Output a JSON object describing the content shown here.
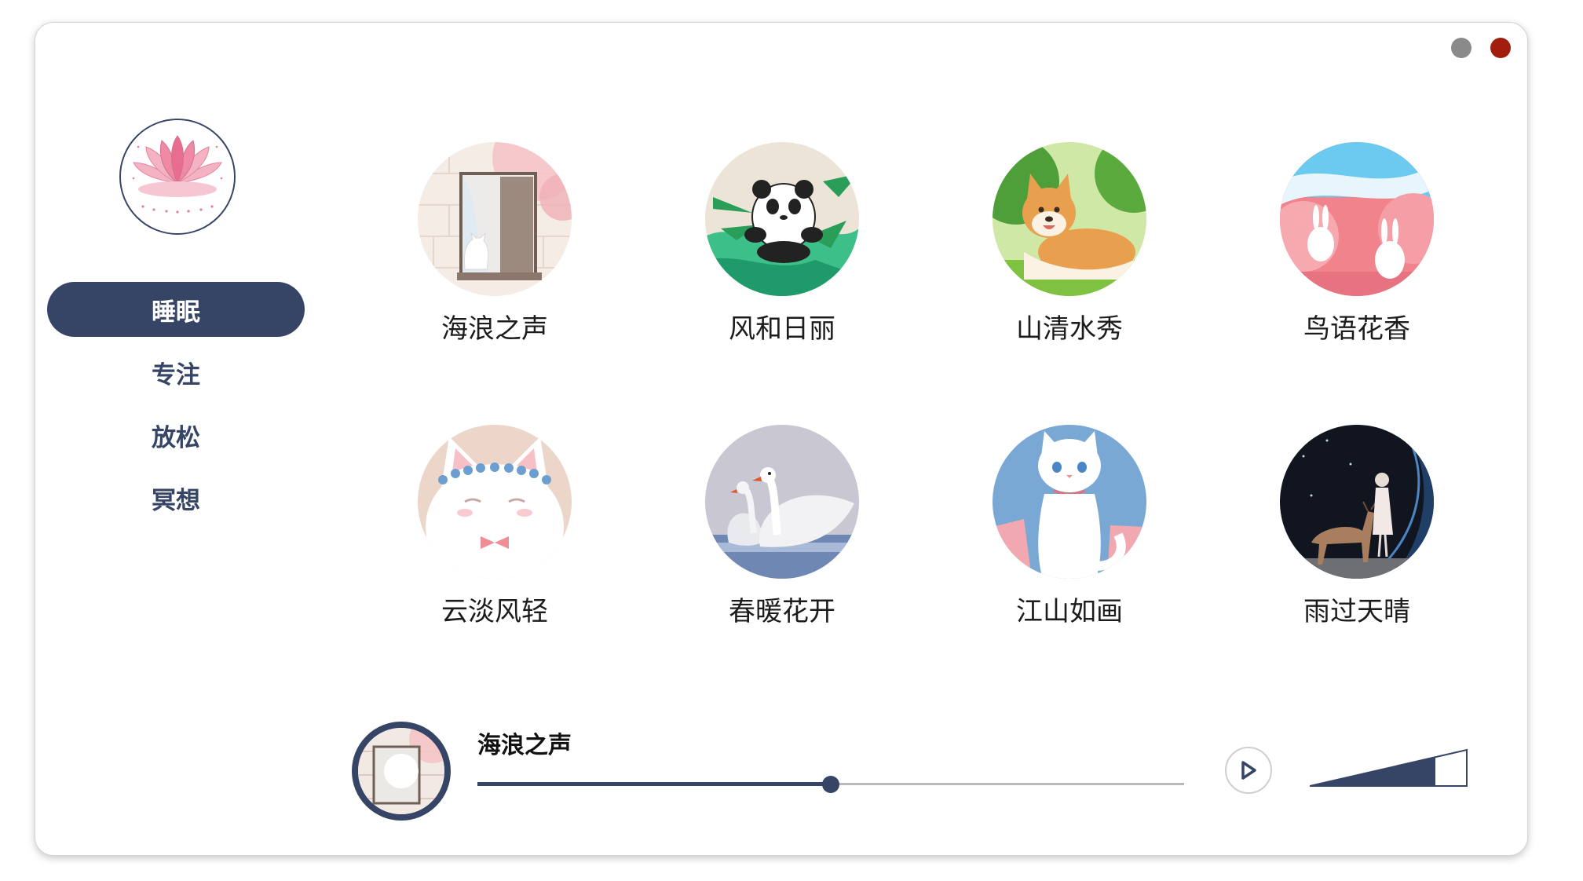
{
  "window": {
    "controls": [
      "minimize",
      "close"
    ],
    "colors": {
      "minimize": "#8a8a8a",
      "close": "#a11e0e"
    }
  },
  "sidebar": {
    "logo_icon": "lotus-icon",
    "items": [
      {
        "label": "睡眠",
        "active": true
      },
      {
        "label": "专注",
        "active": false
      },
      {
        "label": "放松",
        "active": false
      },
      {
        "label": "冥想",
        "active": false
      }
    ]
  },
  "sounds": [
    {
      "label": "海浪之声",
      "image": "cat-window-illustration"
    },
    {
      "label": "风和日丽",
      "image": "panda-bamboo-illustration"
    },
    {
      "label": "山清水秀",
      "image": "shiba-dog-illustration"
    },
    {
      "label": "鸟语花香",
      "image": "rabbits-blossom-illustration"
    },
    {
      "label": "云淡风轻",
      "image": "white-cat-flower-crown-illustration"
    },
    {
      "label": "春暖花开",
      "image": "swans-illustration"
    },
    {
      "label": "江山如画",
      "image": "white-cat-sitting-illustration"
    },
    {
      "label": "雨过天晴",
      "image": "girl-and-deer-night-illustration"
    }
  ],
  "player": {
    "title": "海浪之声",
    "progress": 0.5,
    "play_icon": "play-icon",
    "volume_icon": "volume-bar-icon",
    "volume_level": 0.8
  },
  "colors": {
    "accent": "#364466",
    "track": "#b9b9b9"
  }
}
